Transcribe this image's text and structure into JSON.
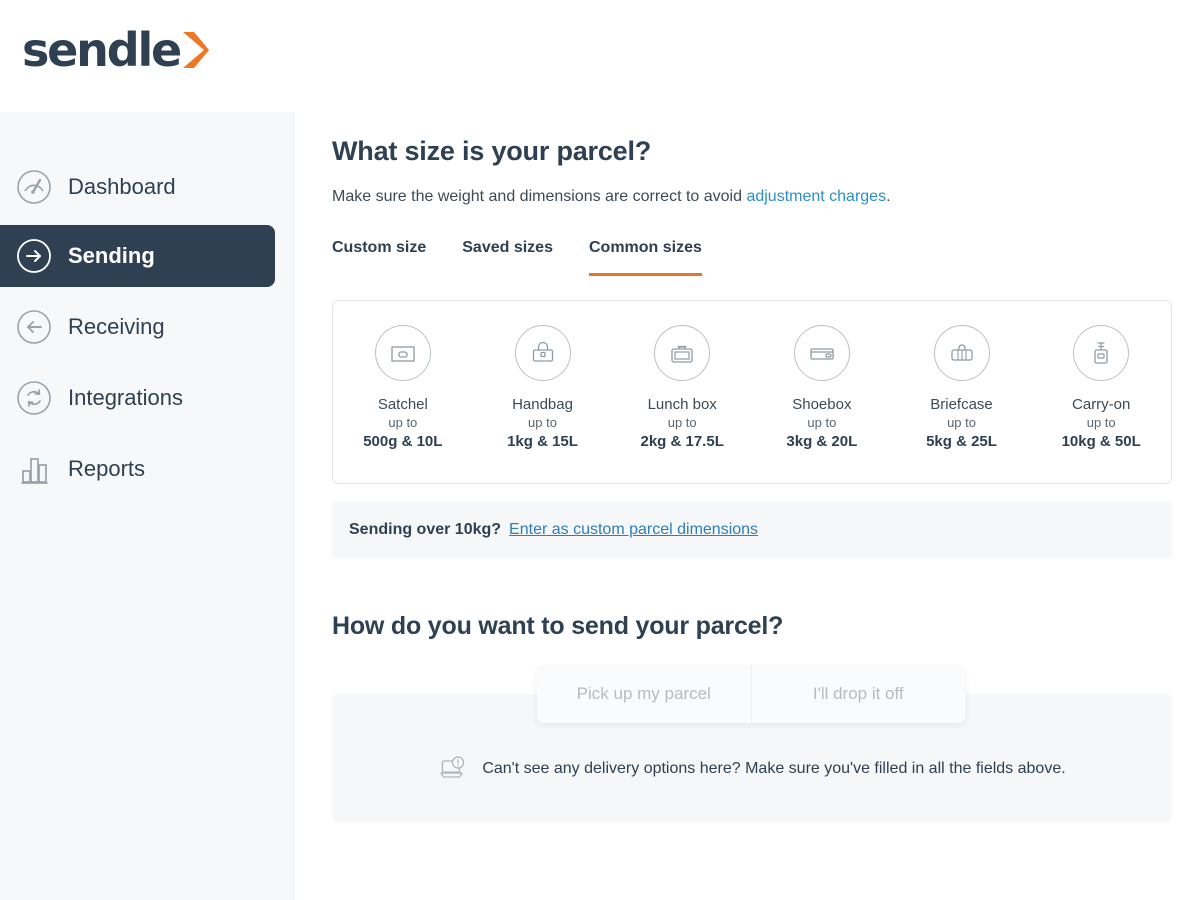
{
  "brand": {
    "logo_text": "sendle",
    "logo_icon": "chevron-right-icon",
    "navy": "#2e4052",
    "orange": "#ef7622",
    "link_blue": "#2e8fc4"
  },
  "sidebar": {
    "items": [
      {
        "label": "Dashboard",
        "icon": "gauge-icon",
        "active": false
      },
      {
        "label": "Sending",
        "icon": "arrow-right-icon",
        "active": true
      },
      {
        "label": "Receiving",
        "icon": "arrow-left-icon",
        "active": false
      },
      {
        "label": "Integrations",
        "icon": "sync-icon",
        "active": false
      },
      {
        "label": "Reports",
        "icon": "bar-chart-icon",
        "active": false
      }
    ]
  },
  "main": {
    "page_title": "What size is your parcel?",
    "subtitle_prefix": "Make sure the weight and dimensions are correct to avoid ",
    "subtitle_link": "adjustment charges",
    "subtitle_suffix": ".",
    "tabs": [
      {
        "label": "Custom size",
        "active": false
      },
      {
        "label": "Saved sizes",
        "active": false
      },
      {
        "label": "Common sizes",
        "active": true
      }
    ],
    "sizes": [
      {
        "name": "Satchel",
        "upto": "up to",
        "limit": "500g & 10L",
        "icon": "satchel-icon"
      },
      {
        "name": "Handbag",
        "upto": "up to",
        "limit": "1kg & 15L",
        "icon": "handbag-icon"
      },
      {
        "name": "Lunch box",
        "upto": "up to",
        "limit": "2kg & 17.5L",
        "icon": "lunchbox-icon"
      },
      {
        "name": "Shoebox",
        "upto": "up to",
        "limit": "3kg & 20L",
        "icon": "shoebox-icon"
      },
      {
        "name": "Briefcase",
        "upto": "up to",
        "limit": "5kg & 25L",
        "icon": "briefcase-icon"
      },
      {
        "name": "Carry-on",
        "upto": "up to",
        "limit": "10kg & 50L",
        "icon": "carryon-icon"
      }
    ],
    "over_banner": {
      "text": "Sending over 10kg?",
      "link": "Enter as custom parcel dimensions"
    },
    "send_title": "How do you want to send your parcel?",
    "send_options": [
      {
        "label": "Pick up my parcel",
        "selected": false,
        "disabled": true
      },
      {
        "label": "I'll drop it off",
        "selected": false,
        "disabled": true
      }
    ],
    "hint": {
      "icon": "laptop-alert-icon",
      "text": "Can't see any delivery options here? Make sure you've filled in all the fields above."
    }
  }
}
